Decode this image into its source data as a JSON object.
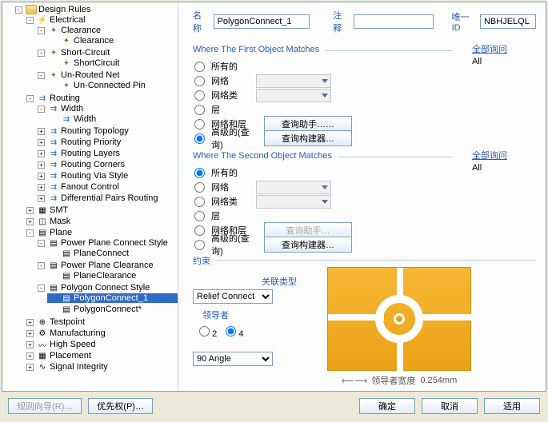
{
  "tree": {
    "root": "Design Rules",
    "electrical": "Electrical",
    "clearance_g": "Clearance",
    "clearance": "Clearance",
    "short_g": "Short-Circuit",
    "short": "ShortCircuit",
    "unrouted_g": "Un-Routed Net",
    "unrouted": "Un-Connected Pin",
    "routing": "Routing",
    "width_g": "Width",
    "width": "Width",
    "rtopo": "Routing Topology",
    "rprio": "Routing Priority",
    "rlayers": "Routing Layers",
    "rcorners": "Routing Corners",
    "rvia": "Routing Via Style",
    "fanout": "Fanout Control",
    "diffpair": "Differential Pairs Routing",
    "smt": "SMT",
    "mask": "Mask",
    "plane": "Plane",
    "ppcs_g": "Power Plane Connect Style",
    "ppcs": "PlaneConnect",
    "ppc_g": "Power Plane Clearance",
    "ppc": "PlaneClearance",
    "polycs_g": "Polygon Connect Style",
    "polycs1": "PolygonConnect_1",
    "polycs2": "PolygonConnect*",
    "testpoint": "Testpoint",
    "mfg": "Manufacturing",
    "hs": "High Speed",
    "placement": "Placement",
    "si": "Signal Integrity"
  },
  "top": {
    "name_lbl": "名称",
    "name_val": "PolygonConnect_1",
    "comment_lbl": "注释",
    "comment_val": "",
    "uid_lbl": "唯一ID",
    "uid_val": "NBHJELQL"
  },
  "match1": {
    "legend": "Where The First Object Matches",
    "r_all": "所有的",
    "r_net": "网络",
    "r_netclass": "网络类",
    "r_layer": "层",
    "r_netlayer": "网络和层",
    "r_adv": "高级的(查询)",
    "btn_helper": "查询助手……",
    "btn_builder": "查询构建器…",
    "q_lbl": "全部询问",
    "q_val": "All"
  },
  "match2": {
    "legend": "Where The Second Object Matches",
    "r_all": "所有的",
    "r_net": "网络",
    "r_netclass": "网络类",
    "r_layer": "层",
    "r_netlayer": "网络和层",
    "r_adv": "高级的(查询)",
    "btn_helper": "查询助手…",
    "btn_builder": "查询构建器…",
    "q_lbl": "全部询问",
    "q_val": "All"
  },
  "constraints": {
    "legend": "约束",
    "style_lbl": "关联类型",
    "style_val": "Relief Connect",
    "cond_lbl": "领导者",
    "cond_2": "2",
    "cond_4": "4",
    "angle_val": "90 Angle",
    "width_lbl": "领导者宽度",
    "width_val": "0.254mm"
  },
  "buttons": {
    "rule_wizard": "规则向导(R)…",
    "priorities": "优先权(P)…",
    "ok": "确定",
    "cancel": "取消",
    "apply": "适用"
  }
}
